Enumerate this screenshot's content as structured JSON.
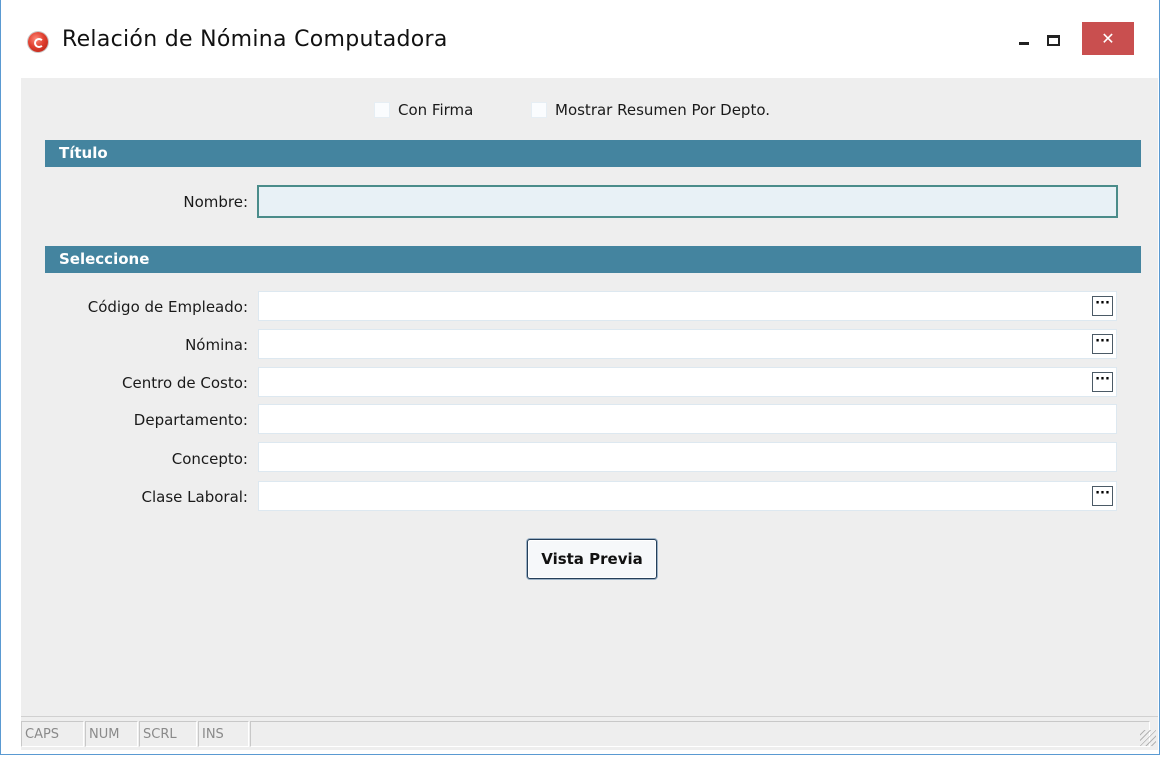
{
  "window": {
    "title": "Relación de Nómina Computadora"
  },
  "options": {
    "con_firma": "Con Firma",
    "mostrar_resumen": "Mostrar Resumen Por Depto."
  },
  "titulo_section": {
    "header": "Título",
    "nombre_label": "Nombre:",
    "nombre_value": ""
  },
  "seleccione_section": {
    "header": "Seleccione",
    "fields": [
      {
        "label": "Código de Empleado:",
        "value": "",
        "has_lookup": true
      },
      {
        "label": "Nómina:",
        "value": "",
        "has_lookup": true
      },
      {
        "label": "Centro de Costo:",
        "value": "",
        "has_lookup": true
      },
      {
        "label": "Departamento:",
        "value": "",
        "has_lookup": false
      },
      {
        "label": "Concepto:",
        "value": "",
        "has_lookup": false
      },
      {
        "label": "Clase Laboral:",
        "value": "",
        "has_lookup": true
      }
    ],
    "lookup_glyph": "···"
  },
  "buttons": {
    "preview": "Vista Previa"
  },
  "statusbar": {
    "caps": "CAPS",
    "num": "NUM",
    "scrl": "SCRL",
    "ins": "INS"
  },
  "colors": {
    "section_band": "#44849f",
    "close_button": "#c94f4f",
    "window_border": "#5a9ad2"
  }
}
